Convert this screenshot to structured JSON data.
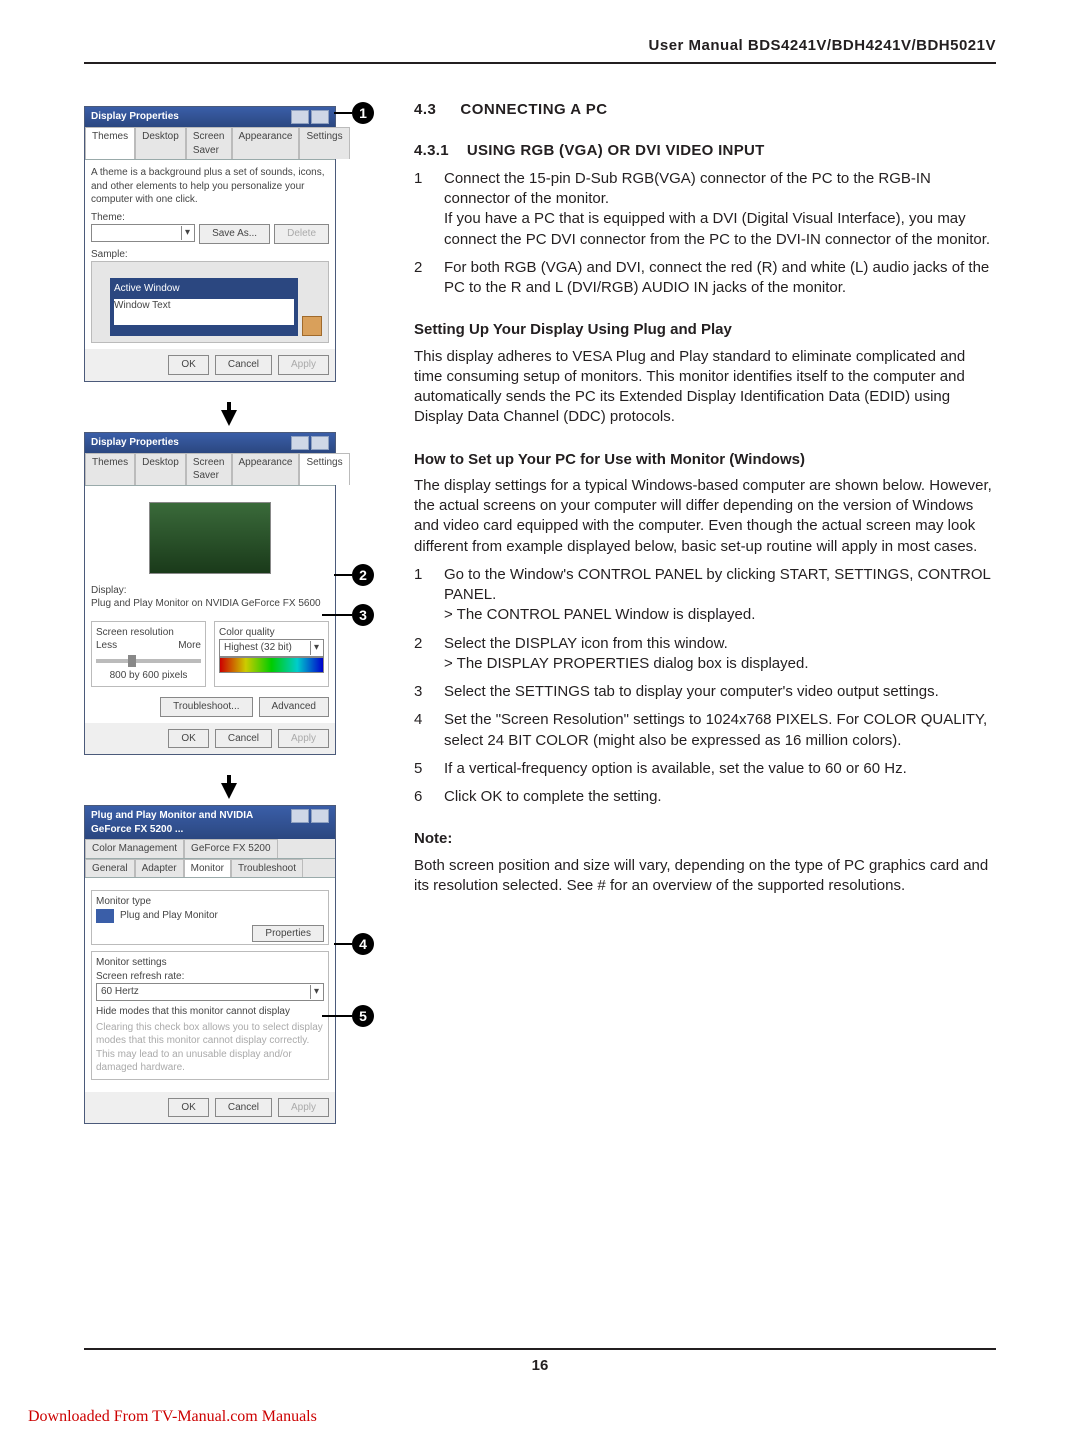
{
  "header": {
    "title": "User Manual BDS4241V/BDH4241V/BDH5021V"
  },
  "page_number": "16",
  "download_line": "Downloaded From TV-Manual.com Manuals",
  "right": {
    "sec_no": "4.3",
    "sec_title": "CONNECTING A PC",
    "sub_no": "4.3.1",
    "sub_title": "USING RGB (VGA) OR DVI VIDEO INPUT",
    "steps_a": [
      "Connect the 15-pin D-Sub RGB(VGA) connector of the PC to the RGB-IN connector of the monitor.\nIf you have a PC that is equipped with a DVI (Digital Visual Interface), you may connect the PC DVI connector from the PC to the DVI-IN connector of the monitor.",
      "For both RGB (VGA) and DVI, connect the red (R) and white (L) audio jacks of the PC to the R and L (DVI/RGB) AUDIO IN jacks of the monitor."
    ],
    "pnp_head": "Setting Up Your Display Using Plug and Play",
    "pnp_body": "This display adheres to VESA Plug and Play standard to eliminate complicated and time consuming setup of monitors. This monitor identifies itself to the computer and automatically sends the PC its Extended Display Identification Data (EDID) using Display Data Channel (DDC) protocols.",
    "win_head": "How to Set up Your PC for Use with Monitor (Windows)",
    "win_body": "The display settings for a typical Windows-based computer are shown below. However, the actual screens on your computer will differ depending on the version of Windows and video card equipped with the computer. Even though the actual screen may look different from example displayed below, basic set-up routine will apply in most cases.",
    "steps_b": [
      "Go to the Window's CONTROL PANEL by clicking START, SETTINGS, CONTROL PANEL.\n> The CONTROL PANEL Window is displayed.",
      "Select the DISPLAY icon from this window.\n> The DISPLAY PROPERTIES dialog box is displayed.",
      "Select the SETTINGS tab to display your computer's video output settings.",
      "Set the \"Screen Resolution\" settings to 1024x768 PIXELS. For COLOR QUALITY, select 24 BIT COLOR (might also be expressed as 16 million colors).",
      "If a vertical-frequency option is available, set the value to 60 or 60 Hz.",
      "Click OK to complete the setting."
    ],
    "note_head": "Note:",
    "note_body": "Both screen position and size will vary, depending on the type of PC graphics card and its resolution selected. See # for an overview of the supported resolutions."
  },
  "dlg1": {
    "title": "Display Properties",
    "tabs": [
      "Themes",
      "Desktop",
      "Screen Saver",
      "Appearance",
      "Settings"
    ],
    "active_tab": "Themes",
    "desc": "A theme is a background plus a set of sounds, icons, and other elements to help you personalize your computer with one click.",
    "theme_label": "Theme:",
    "theme_value": "",
    "saveas": "Save As...",
    "delete": "Delete",
    "sample_label": "Sample:",
    "active_window": "Active Window",
    "window_text": "Window Text",
    "ok": "OK",
    "cancel": "Cancel",
    "apply": "Apply"
  },
  "dlg2": {
    "title": "Display Properties",
    "tabs": [
      "Themes",
      "Desktop",
      "Screen Saver",
      "Appearance",
      "Settings"
    ],
    "active_tab": "Settings",
    "display_label": "Display:",
    "display_value": "Plug and Play Monitor on NVIDIA GeForce FX 5600",
    "res_label": "Screen resolution",
    "less": "Less",
    "more": "More",
    "res_value": "800 by 600 pixels",
    "color_label": "Color quality",
    "color_value": "Highest (32 bit)",
    "troubleshoot": "Troubleshoot...",
    "advanced": "Advanced",
    "ok": "OK",
    "cancel": "Cancel",
    "apply": "Apply"
  },
  "dlg3": {
    "title": "Plug and Play Monitor and NVIDIA GeForce FX 5200 ...",
    "tabs_row1": [
      "Color Management",
      "GeForce FX 5200"
    ],
    "tabs_row2": [
      "General",
      "Adapter",
      "Monitor",
      "Troubleshoot"
    ],
    "active_tab": "Monitor",
    "mtype_label": "Monitor type",
    "mtype_value": "Plug and Play Monitor",
    "properties": "Properties",
    "mset_label": "Monitor settings",
    "refresh_label": "Screen refresh rate:",
    "refresh_value": "60 Hertz",
    "hide_check": "Hide modes that this monitor cannot display",
    "warn": "Clearing this check box allows you to select display modes that this monitor cannot display correctly. This may lead to an unusable display and/or damaged hardware.",
    "ok": "OK",
    "cancel": "Cancel",
    "apply": "Apply"
  },
  "callouts": {
    "c1": "1",
    "c2": "2",
    "c3": "3",
    "c4": "4",
    "c5": "5"
  }
}
